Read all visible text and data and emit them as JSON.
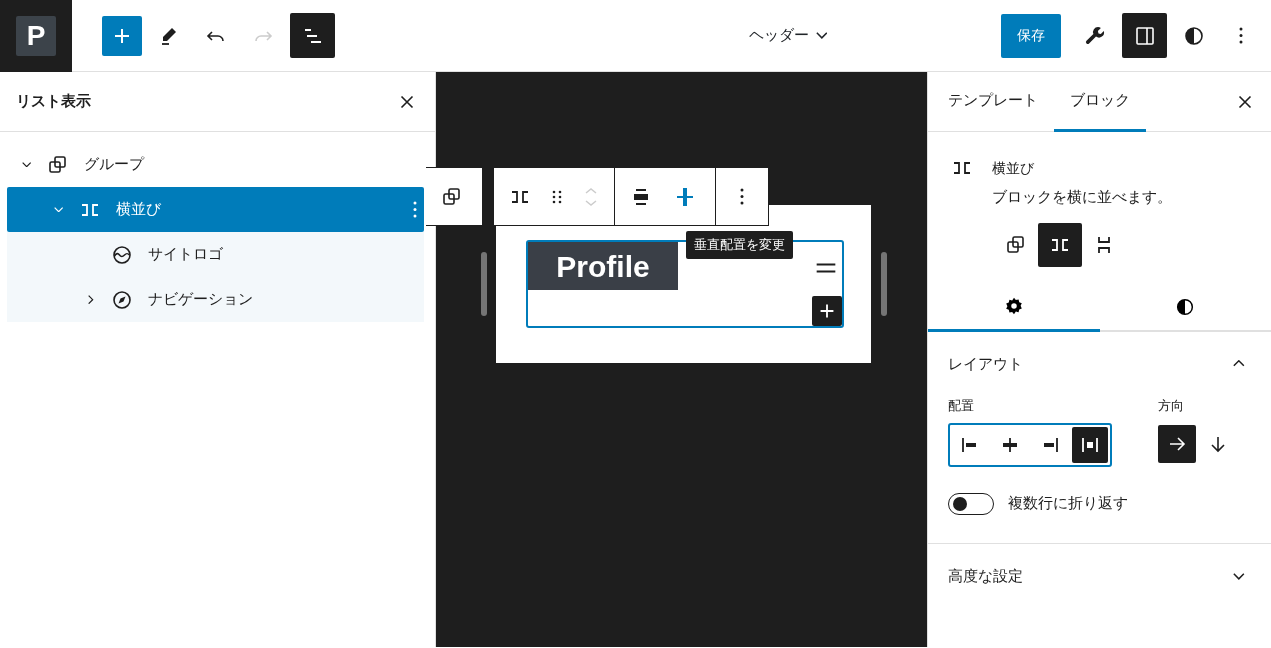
{
  "logo": {
    "letter": "P"
  },
  "toolbar": {
    "redo_disabled": true,
    "list_view_active": true
  },
  "document": {
    "title": "ヘッダー"
  },
  "save_button": {
    "label": "保存"
  },
  "settings_active": true,
  "list_view": {
    "title": "リスト表示",
    "items": [
      {
        "label": "グループ",
        "kind": "group",
        "expanded": true,
        "selected": false,
        "children": [
          {
            "label": "横並び",
            "kind": "row",
            "expanded": true,
            "selected": true,
            "children": [
              {
                "label": "サイトロゴ",
                "kind": "site_logo",
                "selected": false
              },
              {
                "label": "ナビゲーション",
                "kind": "navigation",
                "expanded": false,
                "selected": false
              }
            ]
          }
        ]
      }
    ]
  },
  "canvas": {
    "tooltip": "垂直配置を変更",
    "site_title": "Profile",
    "block_toolbar": [
      {
        "kind": "justify",
        "selected": false
      },
      {
        "kind": "vertical_align",
        "selected": true
      }
    ]
  },
  "inspector": {
    "tabs": [
      {
        "label": "テンプレート",
        "selected": false
      },
      {
        "label": "ブロック",
        "selected": true
      }
    ],
    "block": {
      "name": "横並び",
      "description": "ブロックを横に並べます。"
    },
    "variations": [
      {
        "kind": "group",
        "selected": false
      },
      {
        "kind": "row",
        "selected": true
      },
      {
        "kind": "stack",
        "selected": false
      }
    ],
    "subtabs": [
      {
        "kind": "settings",
        "selected": true
      },
      {
        "kind": "styles",
        "selected": false
      }
    ],
    "layout": {
      "title": "レイアウト",
      "expanded": true,
      "justification_label": "配置",
      "justification": [
        {
          "kind": "left",
          "selected": false
        },
        {
          "kind": "center",
          "selected": false
        },
        {
          "kind": "right",
          "selected": false
        },
        {
          "kind": "space_between",
          "selected": true
        }
      ],
      "orientation_label": "方向",
      "orientation": [
        {
          "kind": "horizontal",
          "selected": true
        },
        {
          "kind": "vertical",
          "selected": false
        }
      ],
      "wrap": {
        "label": "複数行に折り返す",
        "on": false
      }
    },
    "advanced": {
      "title": "高度な設定",
      "expanded": false
    }
  }
}
